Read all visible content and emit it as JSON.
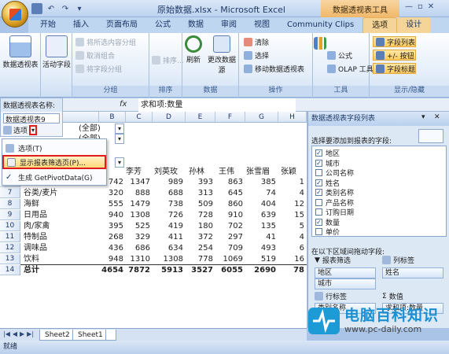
{
  "window": {
    "title": "原始数据.xlsx - Microsoft Excel",
    "context_title": "数据透视表工具"
  },
  "tabs": [
    "开始",
    "插入",
    "页面布局",
    "公式",
    "数据",
    "审阅",
    "视图",
    "Community Clips",
    "选项",
    "设计"
  ],
  "active_tab": "选项",
  "ribbon": {
    "group1": {
      "button": "数据透视表",
      "label": ""
    },
    "group2": {
      "button": "活动字段",
      "label": ""
    },
    "group3": {
      "label": "分组",
      "items": [
        "将所选内容分组",
        "取消组合",
        "将字段分组"
      ]
    },
    "group4": {
      "label": "排序",
      "button": "排序..."
    },
    "group5": {
      "label": "数据",
      "buttons": [
        "刷新",
        "更改数据源"
      ]
    },
    "group6": {
      "label": "操作",
      "items": [
        "清除",
        "选择",
        "移动数据透视表"
      ]
    },
    "group7": {
      "label": "工具",
      "items": [
        "公式",
        "OLAP 工具"
      ]
    },
    "group8": {
      "label": "显示/隐藏",
      "items": [
        "字段列表",
        "+/- 按钮",
        "字段标题"
      ]
    }
  },
  "formula_bar": {
    "namebox": "",
    "fx": "fx",
    "formula": "求和项:数量"
  },
  "pivot_name_box": {
    "label": "数据透视表名称:",
    "value": "数据透视表9",
    "options_label": "选项"
  },
  "context_menu": {
    "items": [
      "选项(T)",
      "显示报表筛选页(P)...",
      "生成 GetPivotData(G)"
    ]
  },
  "grid": {
    "columns": [
      "B",
      "C",
      "D",
      "E",
      "F",
      "G",
      "H"
    ],
    "filter_values": [
      "(全部)",
      "(全部)"
    ],
    "headers": [
      "李芳",
      "刘英玫",
      "孙林",
      "王伟",
      "张雪眉",
      "张颖"
    ],
    "rows": [
      {
        "row": "6",
        "label": "",
        "values": [
          "742",
          "1347",
          "989",
          "393",
          "863",
          "385",
          "1"
        ]
      },
      {
        "row": "7",
        "label": "谷类/麦片",
        "values": [
          "320",
          "888",
          "688",
          "313",
          "645",
          "74",
          "4"
        ]
      },
      {
        "row": "8",
        "label": "海鲜",
        "values": [
          "555",
          "1479",
          "738",
          "509",
          "860",
          "404",
          "12"
        ]
      },
      {
        "row": "9",
        "label": "日用品",
        "values": [
          "940",
          "1308",
          "726",
          "728",
          "910",
          "639",
          "15"
        ]
      },
      {
        "row": "10",
        "label": "肉/家禽",
        "values": [
          "395",
          "525",
          "419",
          "180",
          "702",
          "135",
          "5"
        ]
      },
      {
        "row": "11",
        "label": "特制品",
        "values": [
          "268",
          "329",
          "411",
          "372",
          "297",
          "41",
          "4"
        ]
      },
      {
        "row": "12",
        "label": "调味品",
        "values": [
          "436",
          "686",
          "634",
          "254",
          "709",
          "493",
          "6"
        ]
      },
      {
        "row": "13",
        "label": "饮料",
        "values": [
          "948",
          "1310",
          "1308",
          "778",
          "1069",
          "519",
          "16"
        ]
      },
      {
        "row": "14",
        "label": "总计",
        "values": [
          "4654",
          "7872",
          "5913",
          "3527",
          "6055",
          "2690",
          "78"
        ]
      }
    ]
  },
  "pane": {
    "title": "数据透视表字段列表",
    "choose_label": "选择要添加到报表的字段:",
    "fields": [
      {
        "name": "地区",
        "checked": true
      },
      {
        "name": "城市",
        "checked": true
      },
      {
        "name": "公司名称",
        "checked": false
      },
      {
        "name": "姓名",
        "checked": true
      },
      {
        "name": "类别名称",
        "checked": true
      },
      {
        "name": "产品名称",
        "checked": false
      },
      {
        "name": "订购日期",
        "checked": false
      },
      {
        "name": "数量",
        "checked": true
      },
      {
        "name": "单价",
        "checked": false
      }
    ],
    "drag_label": "在以下区域间拖动字段:",
    "zones": {
      "filter": "报表筛选",
      "column": "列标签",
      "row": "行标签",
      "values": "数值",
      "filter_items": [
        "地区",
        "城市"
      ],
      "column_items": [
        "姓名"
      ],
      "row_items": [
        "类别名称"
      ],
      "value_items": [
        "求和项:数量"
      ]
    }
  },
  "sheets": [
    "Sheet2",
    "Sheet1"
  ],
  "status": "就绪",
  "watermark": {
    "title": "电脑百科知识",
    "url": "www.pc-daily.com"
  }
}
